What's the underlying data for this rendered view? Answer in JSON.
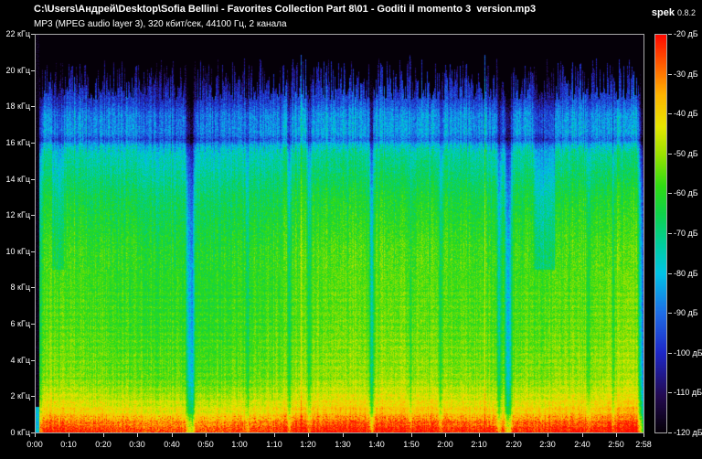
{
  "header": {
    "file_path": "C:\\Users\\Андрей\\Desktop\\Sofia Bellini - Favorites Collection Part 8\\01 - Goditi il momento 3  version.mp3",
    "app_name": "spek",
    "app_version": "0.8.2",
    "stream_info": "MP3 (MPEG audio layer 3), 320 кбит/сек, 44100 Гц, 2 канала"
  },
  "axes": {
    "frequency": {
      "unit": "кГц",
      "min_khz": 0,
      "max_khz": 22,
      "step_khz": 2,
      "tick_labels": [
        "22 кГц",
        "20 кГц",
        "18 кГц",
        "16 кГц",
        "14 кГц",
        "12 кГц",
        "10 кГц",
        "8 кГц",
        "6 кГц",
        "4 кГц",
        "2 кГц",
        "0 кГц"
      ]
    },
    "time": {
      "duration_seconds": 178,
      "tick_seconds": [
        0,
        10,
        20,
        30,
        40,
        50,
        60,
        70,
        80,
        90,
        100,
        110,
        120,
        130,
        140,
        150,
        160,
        170,
        178
      ],
      "tick_labels": [
        "0:00",
        "0:10",
        "0:20",
        "0:30",
        "0:40",
        "0:50",
        "1:00",
        "1:10",
        "1:20",
        "1:30",
        "1:40",
        "1:50",
        "2:00",
        "2:10",
        "2:20",
        "2:30",
        "2:40",
        "2:50",
        "2:58"
      ]
    },
    "level": {
      "unit": "дБ",
      "max_db": -20,
      "min_db": -120,
      "step_db": 10,
      "tick_labels": [
        "-20 дБ",
        "-30 дБ",
        "-40 дБ",
        "-50 дБ",
        "-60 дБ",
        "-70 дБ",
        "-80 дБ",
        "-90 дБ",
        "-100 дБ",
        "-110 дБ",
        "-120 дБ"
      ]
    }
  },
  "spectrogram": {
    "seed": 1337,
    "db_range": [
      -120,
      -20
    ],
    "palette_stops": [
      [
        0.0,
        "#050008"
      ],
      [
        0.09,
        "#230a50"
      ],
      [
        0.2,
        "#1e28c8"
      ],
      [
        0.3,
        "#1e6ee6"
      ],
      [
        0.4,
        "#00c3e6"
      ],
      [
        0.47,
        "#00cda0"
      ],
      [
        0.55,
        "#0fd24a"
      ],
      [
        0.62,
        "#30dc14"
      ],
      [
        0.7,
        "#9be100"
      ],
      [
        0.77,
        "#e6e600"
      ],
      [
        0.85,
        "#ffb400"
      ],
      [
        0.92,
        "#ff6400"
      ],
      [
        1.0,
        "#ff0a00"
      ]
    ],
    "freq_profile_khz_db": [
      [
        0,
        -26
      ],
      [
        0.35,
        -28
      ],
      [
        1,
        -38
      ],
      [
        2,
        -46
      ],
      [
        3,
        -52
      ],
      [
        6,
        -56
      ],
      [
        10,
        -58
      ],
      [
        13,
        -64
      ],
      [
        15.5,
        -74
      ],
      [
        15.9,
        -80
      ],
      [
        16.2,
        -92
      ],
      [
        16.6,
        -85
      ],
      [
        17.6,
        -87
      ],
      [
        18.3,
        -96
      ],
      [
        20.0,
        -107
      ],
      [
        22,
        -112
      ]
    ],
    "cutoff_khz_base": 18.4,
    "cutoff_khz_spread": 2.3,
    "quiet_gaps_sec_width_db": [
      [
        44.9,
        0.55,
        24
      ],
      [
        45.9,
        0.35,
        18
      ],
      [
        62,
        0.3,
        10
      ],
      [
        74.2,
        0.3,
        12
      ],
      [
        80,
        0.35,
        10
      ],
      [
        98.3,
        0.5,
        22
      ],
      [
        109.6,
        0.3,
        12
      ],
      [
        118.4,
        0.3,
        9
      ],
      [
        135.6,
        0.4,
        14
      ],
      [
        138.3,
        0.7,
        26
      ],
      [
        161.7,
        0.3,
        10
      ],
      [
        169,
        0.3,
        9
      ]
    ],
    "high_quiet_zones_sec_db": [
      [
        4.5,
        8.5,
        8
      ],
      [
        145.8,
        152.3,
        11
      ]
    ],
    "tall_spike_secs": [
      77.5,
      109.5,
      131.5
    ],
    "start_fade_sec": 2.4,
    "end_fade_sec": 1.9
  }
}
